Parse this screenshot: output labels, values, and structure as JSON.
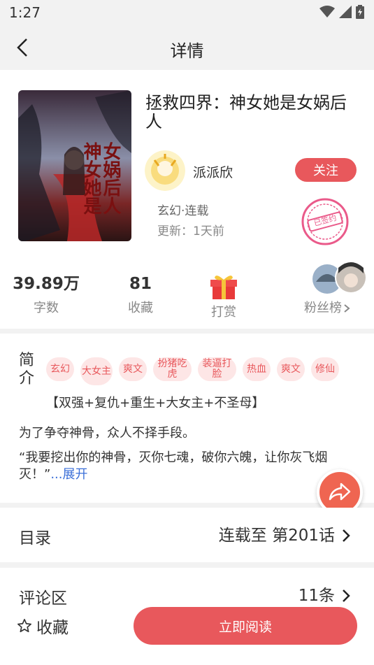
{
  "status": {
    "time": "1:27"
  },
  "header": {
    "title": "详情"
  },
  "book": {
    "title": "拯救四界：神女她是女娲后人",
    "author": "派派欣",
    "follow_label": "关注",
    "meta": "玄幻·连载",
    "update": "更新：1天前",
    "stamp_text": "已签约",
    "cover_text": [
      "神女她是",
      "女娲后人"
    ]
  },
  "stats": [
    {
      "value": "39.89万",
      "label": "字数"
    },
    {
      "value": "81",
      "label": "收藏"
    },
    {
      "label": "打赏"
    },
    {
      "label": "粉丝榜"
    }
  ],
  "intro": {
    "label": "简介",
    "tags": [
      "玄幻",
      "大女主",
      "爽文",
      "扮猪吃虎",
      "装逼打脸",
      "热血",
      "爽文",
      "修仙"
    ],
    "subtitle": "【双强+复仇+重生+大女主+不圣母】",
    "p1": "为了争夺神骨，众人不择手段。",
    "p2": "“我要挖出你的神骨，灭你七魂，破你六魄，让你灰飞烟灭！”",
    "expand": "...展开"
  },
  "toc": {
    "label": "目录",
    "status": "连载至 第201话"
  },
  "comments": {
    "label": "评论区",
    "count": "11条"
  },
  "bottom": {
    "collect_label": "收藏",
    "read_label": "立即阅读"
  },
  "colors": {
    "accent": "#e8585c",
    "link": "#3b6fd8",
    "tag_bg": "#fde6e6"
  }
}
